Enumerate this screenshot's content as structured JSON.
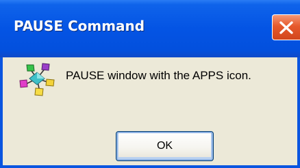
{
  "dialog": {
    "title": "PAUSE Command",
    "message": "PAUSE window with the APPS icon.",
    "ok_label": "OK",
    "icon": "apps-icon",
    "close_icon": "close-icon"
  },
  "colors": {
    "titlebar": "#0454e4",
    "window_border": "#0a55e0",
    "body": "#ece9d8",
    "close_button": "#e6592c",
    "button_border": "#003c74"
  }
}
